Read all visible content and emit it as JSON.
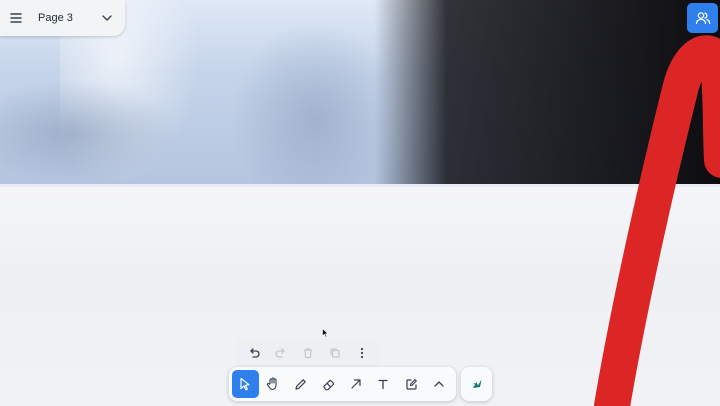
{
  "page_menu": {
    "current_page": "Page 3",
    "menu_icon": "hamburger-icon",
    "dropdown_icon": "chevron-down-icon"
  },
  "share_button": {
    "icon": "people-icon",
    "color": "#2f80ed"
  },
  "actions_bar": {
    "items": [
      {
        "name": "undo",
        "icon": "undo-icon",
        "enabled": true
      },
      {
        "name": "redo",
        "icon": "redo-icon",
        "enabled": false
      },
      {
        "name": "delete",
        "icon": "trash-icon",
        "enabled": false
      },
      {
        "name": "duplicate",
        "icon": "duplicate-icon",
        "enabled": false
      },
      {
        "name": "more",
        "icon": "more-vertical-icon",
        "enabled": true
      }
    ]
  },
  "toolbar": {
    "active_tool": "select",
    "accent_color": "#2f80ed",
    "tools": [
      {
        "name": "select",
        "icon": "pointer-icon"
      },
      {
        "name": "hand",
        "icon": "hand-icon"
      },
      {
        "name": "draw",
        "icon": "pencil-icon"
      },
      {
        "name": "eraser",
        "icon": "eraser-icon"
      },
      {
        "name": "arrow",
        "icon": "arrow-icon"
      },
      {
        "name": "text",
        "icon": "text-icon"
      },
      {
        "name": "note",
        "icon": "note-icon"
      },
      {
        "name": "more-tools",
        "icon": "chevron-up-icon"
      }
    ],
    "helper_icon": "helper-icon",
    "helper_color": "#0f766e"
  },
  "canvas": {
    "stroke_color": "#dc2626"
  }
}
